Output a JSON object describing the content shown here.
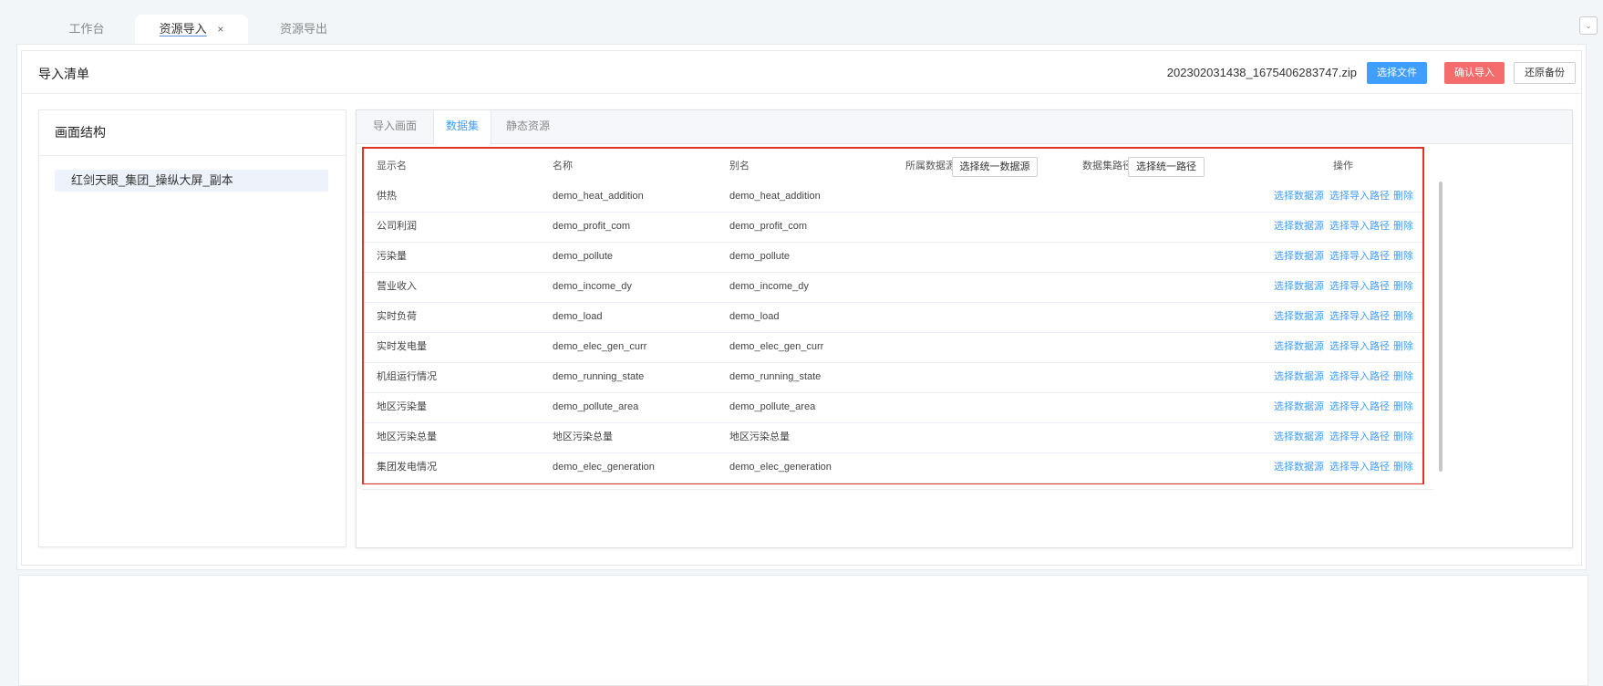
{
  "tabs": [
    {
      "label": "工作台",
      "active": false
    },
    {
      "label": "资源导入",
      "active": true,
      "close": "×"
    },
    {
      "label": "资源导出",
      "active": false
    }
  ],
  "collapse_icon": "chevron-down-icon",
  "header": {
    "title": "导入清单",
    "filename": "202302031438_1675406283747.zip",
    "select_file": "选择文件",
    "confirm_import": "确认导入",
    "restore_backup": "还原备份"
  },
  "structure": {
    "title": "画面结构",
    "item": "红剑天眼_集团_操纵大屏_副本"
  },
  "subtabs": [
    {
      "label": "导入画面",
      "active": false
    },
    {
      "label": "数据集",
      "active": true
    },
    {
      "label": "静态资源",
      "active": false
    }
  ],
  "table": {
    "columns": {
      "display": "显示名",
      "name": "名称",
      "alias": "别名",
      "source": "所属数据源",
      "source_btn": "选择统一数据源",
      "path": "数据集路径",
      "path_btn": "选择统一路径",
      "ops": "操作"
    },
    "actions": {
      "select_source": "选择数据源",
      "select_path": "选择导入路径",
      "delete": "删除"
    },
    "rows": [
      {
        "display": "供热",
        "name": "demo_heat_addition",
        "alias": "demo_heat_addition"
      },
      {
        "display": "公司利润",
        "name": "demo_profit_com",
        "alias": "demo_profit_com"
      },
      {
        "display": "污染量",
        "name": "demo_pollute",
        "alias": "demo_pollute"
      },
      {
        "display": "营业收入",
        "name": "demo_income_dy",
        "alias": "demo_income_dy"
      },
      {
        "display": "实时负荷",
        "name": "demo_load",
        "alias": "demo_load"
      },
      {
        "display": "实时发电量",
        "name": "demo_elec_gen_curr",
        "alias": "demo_elec_gen_curr"
      },
      {
        "display": "机组运行情况",
        "name": "demo_running_state",
        "alias": "demo_running_state"
      },
      {
        "display": "地区污染量",
        "name": "demo_pollute_area",
        "alias": "demo_pollute_area"
      },
      {
        "display": "地区污染总量",
        "name": "地区污染总量",
        "alias": "地区污染总量"
      },
      {
        "display": "集团发电情况",
        "name": "demo_elec_generation",
        "alias": "demo_elec_generation"
      }
    ]
  },
  "colors": {
    "accent": "#409eff",
    "danger": "#f56c6c",
    "highlight_border": "#e53228"
  }
}
